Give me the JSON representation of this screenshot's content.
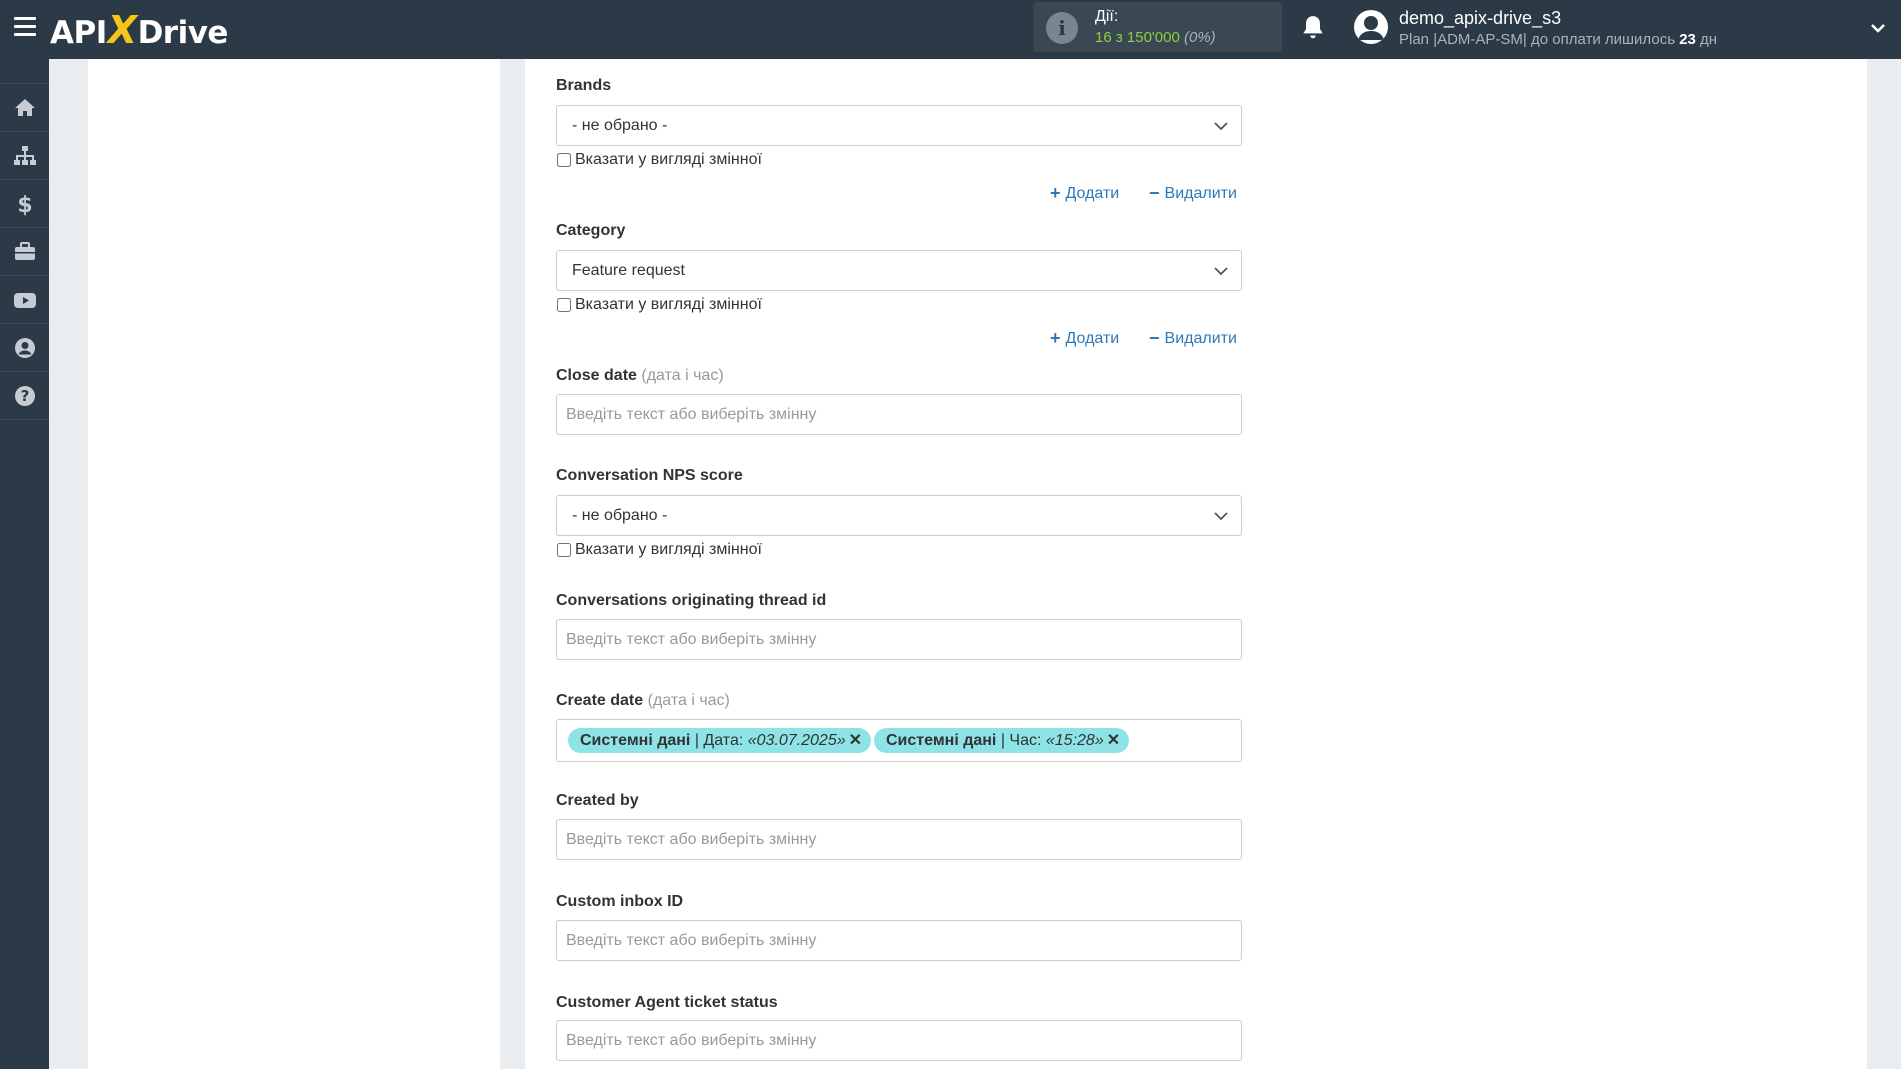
{
  "header": {
    "logo_left": "API",
    "logo_x": "X",
    "logo_right": "Drive",
    "actions_label": "Дії:",
    "actions_count": "16 з 150'000",
    "actions_percent": "(0%)",
    "user_name": "demo_apix-drive_s3",
    "plan_prefix": "Plan |ADM-AP-SM| до оплати лишилось ",
    "plan_days": "23",
    "plan_suffix": " дн"
  },
  "sidebar": {
    "icons": [
      "home-icon",
      "sitemap-icon",
      "dollar-icon",
      "briefcase-icon",
      "youtube-icon",
      "user-circle-icon",
      "question-icon"
    ]
  },
  "form": {
    "brands": {
      "label": "Brands",
      "value": "- не обрано -",
      "checkbox": "Вказати у вигляді змінної",
      "add": "Додати",
      "remove": "Видалити"
    },
    "category": {
      "label": "Category",
      "value": "Feature request",
      "checkbox": "Вказати у вигляді змінної",
      "add": "Додати",
      "remove": "Видалити"
    },
    "close_date": {
      "label": "Close date",
      "hint": "(дата і час)",
      "placeholder": "Введіть текст або виберіть змінну"
    },
    "nps": {
      "label": "Conversation NPS score",
      "value": "- не обрано -",
      "checkbox": "Вказати у вигляді змінної"
    },
    "thread_id": {
      "label": "Conversations originating thread id",
      "placeholder": "Введіть текст або виберіть змінну"
    },
    "create_date": {
      "label": "Create date",
      "hint": "(дата і час)",
      "tags": [
        {
          "source": "Системні дані",
          "field": " | Дата: ",
          "value": "«03.07.2025»",
          "remove": "✕"
        },
        {
          "source": "Системні дані",
          "field": " | Час: ",
          "value": "«15:28»",
          "remove": "✕"
        }
      ]
    },
    "created_by": {
      "label": "Created by",
      "placeholder": "Введіть текст або виберіть змінну"
    },
    "custom_inbox": {
      "label": "Custom inbox ID",
      "placeholder": "Введіть текст або виберіть змінну"
    },
    "agent_status": {
      "label": "Customer Agent ticket status",
      "placeholder": "Введіть текст або виберіть змінну"
    }
  },
  "colors": {
    "topbar": "#2c3a47",
    "accent_link": "#2d79b8",
    "tag": "#8ee3e6",
    "count_green": "#8bd13d"
  }
}
